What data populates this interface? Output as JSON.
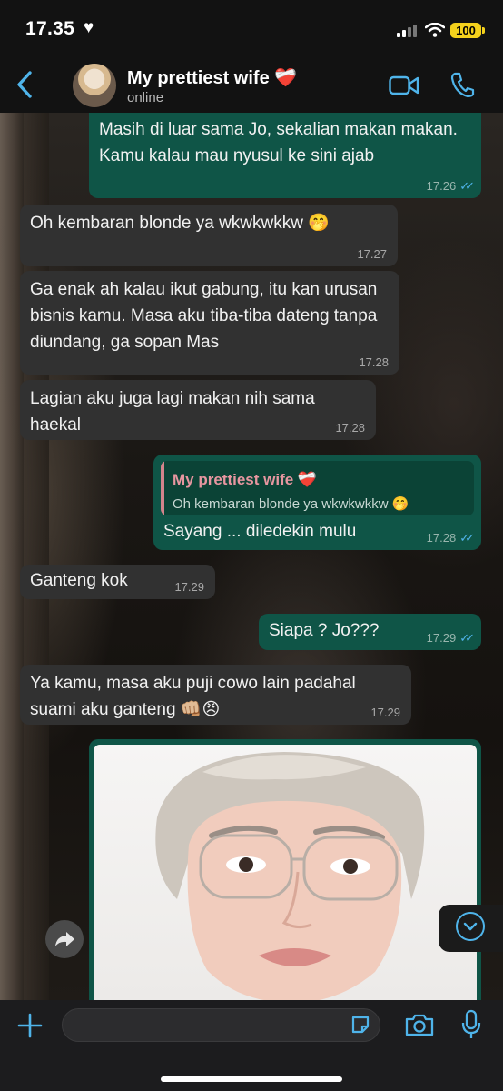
{
  "status_bar": {
    "time": "17.35",
    "heart": "♥",
    "battery": "100"
  },
  "header": {
    "contact_name": "My prettiest wife ❤️‍🩹",
    "contact_status": "online"
  },
  "messages": [
    {
      "dir": "out",
      "text": "Masih di luar sama Jo, sekalian makan makan. Kamu kalau mau nyusul ke sini ajab",
      "time": "17.26"
    },
    {
      "dir": "in",
      "text": "Oh kembaran blonde ya wkwkwkkw 🤭",
      "time": "17.27"
    },
    {
      "dir": "in",
      "text": "Ga enak ah kalau ikut gabung, itu kan urusan bisnis kamu. Masa aku tiba-tiba dateng tanpa diundang, ga sopan Mas",
      "time": "17.28"
    },
    {
      "dir": "in",
      "text": "Lagian aku juga lagi makan nih sama haekal",
      "time": "17.28"
    },
    {
      "dir": "out",
      "reply_name": "My prettiest wife ❤️‍🩹",
      "reply_text": "Oh kembaran blonde ya wkwkwkkw 🤭",
      "text": "Sayang ... diledekin mulu",
      "time": "17.28"
    },
    {
      "dir": "in",
      "text": "Ganteng kok",
      "time": "17.29"
    },
    {
      "dir": "out",
      "text": "Siapa ? Jo???",
      "time": "17.29"
    },
    {
      "dir": "in",
      "text": "Ya kamu, masa aku puji cowo lain padahal suami aku ganteng 👊🏼😠",
      "time": "17.29"
    }
  ],
  "colors": {
    "incoming": "#313131",
    "outgoing": "#0f5547",
    "accent": "#4fb4ea"
  },
  "icons": [
    "back-icon",
    "video-call-icon",
    "phone-icon",
    "forward-icon",
    "scroll-down-icon",
    "plus-icon",
    "sticker-icon",
    "camera-icon",
    "mic-icon"
  ]
}
